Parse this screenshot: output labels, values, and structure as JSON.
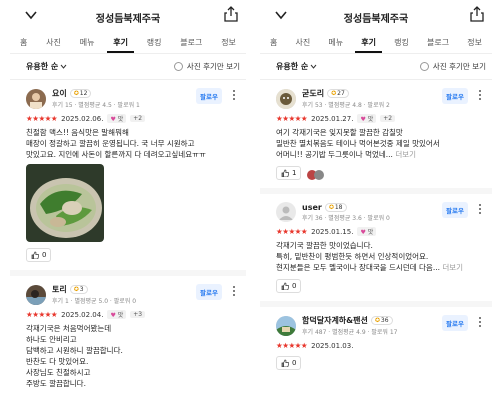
{
  "place_title": "정성듬북제주국",
  "tabs": [
    "홈",
    "사진",
    "메뉴",
    "후기",
    "랭킹",
    "블로그",
    "정보"
  ],
  "sort_label": "유용한 순",
  "photo_only_label": "사진 후기만 보기",
  "follow_label": "팔로우",
  "tag_label": "맛",
  "left_reviews": [
    {
      "name": "요이",
      "badge": "12",
      "meta": "후기 15 · 별점평균 4.5 · 팔로워 1",
      "stars": "★★★★★",
      "date": "2025.02.06.",
      "plus": "+2",
      "body": "친절함 맥스!! 음식맛은 말해뭐해\n매장이 정갈하고 깔끔히 운영됩니다. 국 너무 시원하고\n맛있고요. 지인에 사돈이 할른까지 다 데려오고싶네요ㅠㅠ",
      "likes": "0"
    },
    {
      "name": "토리",
      "badge": "3",
      "meta": "후기 1 · 별점평균 5.0 · 팔로워 0",
      "stars": "★★★★★",
      "date": "2025.02.04.",
      "plus": "+3",
      "body": "각재기국은 처음먹어봤는데\n하나도 안비리고\n담백하고 시원하니 깔끔합니다.\n반찬도 다 맛있어요.\n사장님도 친절하시고\n주방도 깔끔합니다."
    }
  ],
  "right_reviews": [
    {
      "name": "굳도리",
      "badge": "27",
      "meta": "후기 53 · 별점평균 4.8 · 팔로워 2",
      "stars": "★★★★★",
      "date": "2025.01.27.",
      "plus": "+2",
      "body": "여기 각재기국은 잊지못할 깔끔한 감칠맛\n밀반찬 멸치볶음도 테이나 먹어본것중 제일 맛있어서\n어머니!! 공기밥 두그릇이나 먹었네...",
      "more": "더보기",
      "likes": "1"
    },
    {
      "name": "user",
      "badge": "18",
      "meta": "후기 36 · 별점평균 3.6 · 팔로워 0",
      "stars": "★★★★★",
      "date": "2025.01.15.",
      "body": "각재기국 깔끔한 맛이었습니다.\n특히, 밑반찬이 평범한듯 하면서 인상적이었어요.\n현지분들은 모두 멜국이나 장대국을 드시던데 다음...",
      "more": "더보기",
      "likes": "0"
    },
    {
      "name": "함덕달자계하&팬션",
      "badge": "36",
      "meta": "후기 487 · 별점평균 4.9 · 팔로워 17",
      "stars": "★★★★★",
      "date": "2025.01.03.",
      "likes": "0"
    }
  ]
}
